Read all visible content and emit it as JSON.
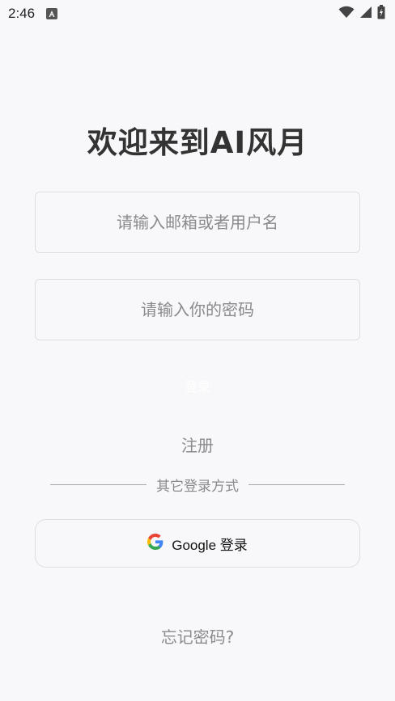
{
  "status_bar": {
    "time": "2:46",
    "icons": [
      "notification-a-icon",
      "wifi-icon",
      "cellular-signal-icon",
      "battery-charging-icon"
    ]
  },
  "title": "欢迎来到AI风月",
  "email_field": {
    "placeholder": "请输入邮箱或者用户名",
    "value": ""
  },
  "password_field": {
    "placeholder": "请输入你的密码",
    "value": ""
  },
  "login_button": {
    "label": "登录"
  },
  "register_link": {
    "label": "注册"
  },
  "divider": {
    "text": "其它登录方式"
  },
  "google_button": {
    "label": "Google 登录",
    "icon": "google-icon"
  },
  "forgot_link": {
    "label": "忘记密码?"
  }
}
